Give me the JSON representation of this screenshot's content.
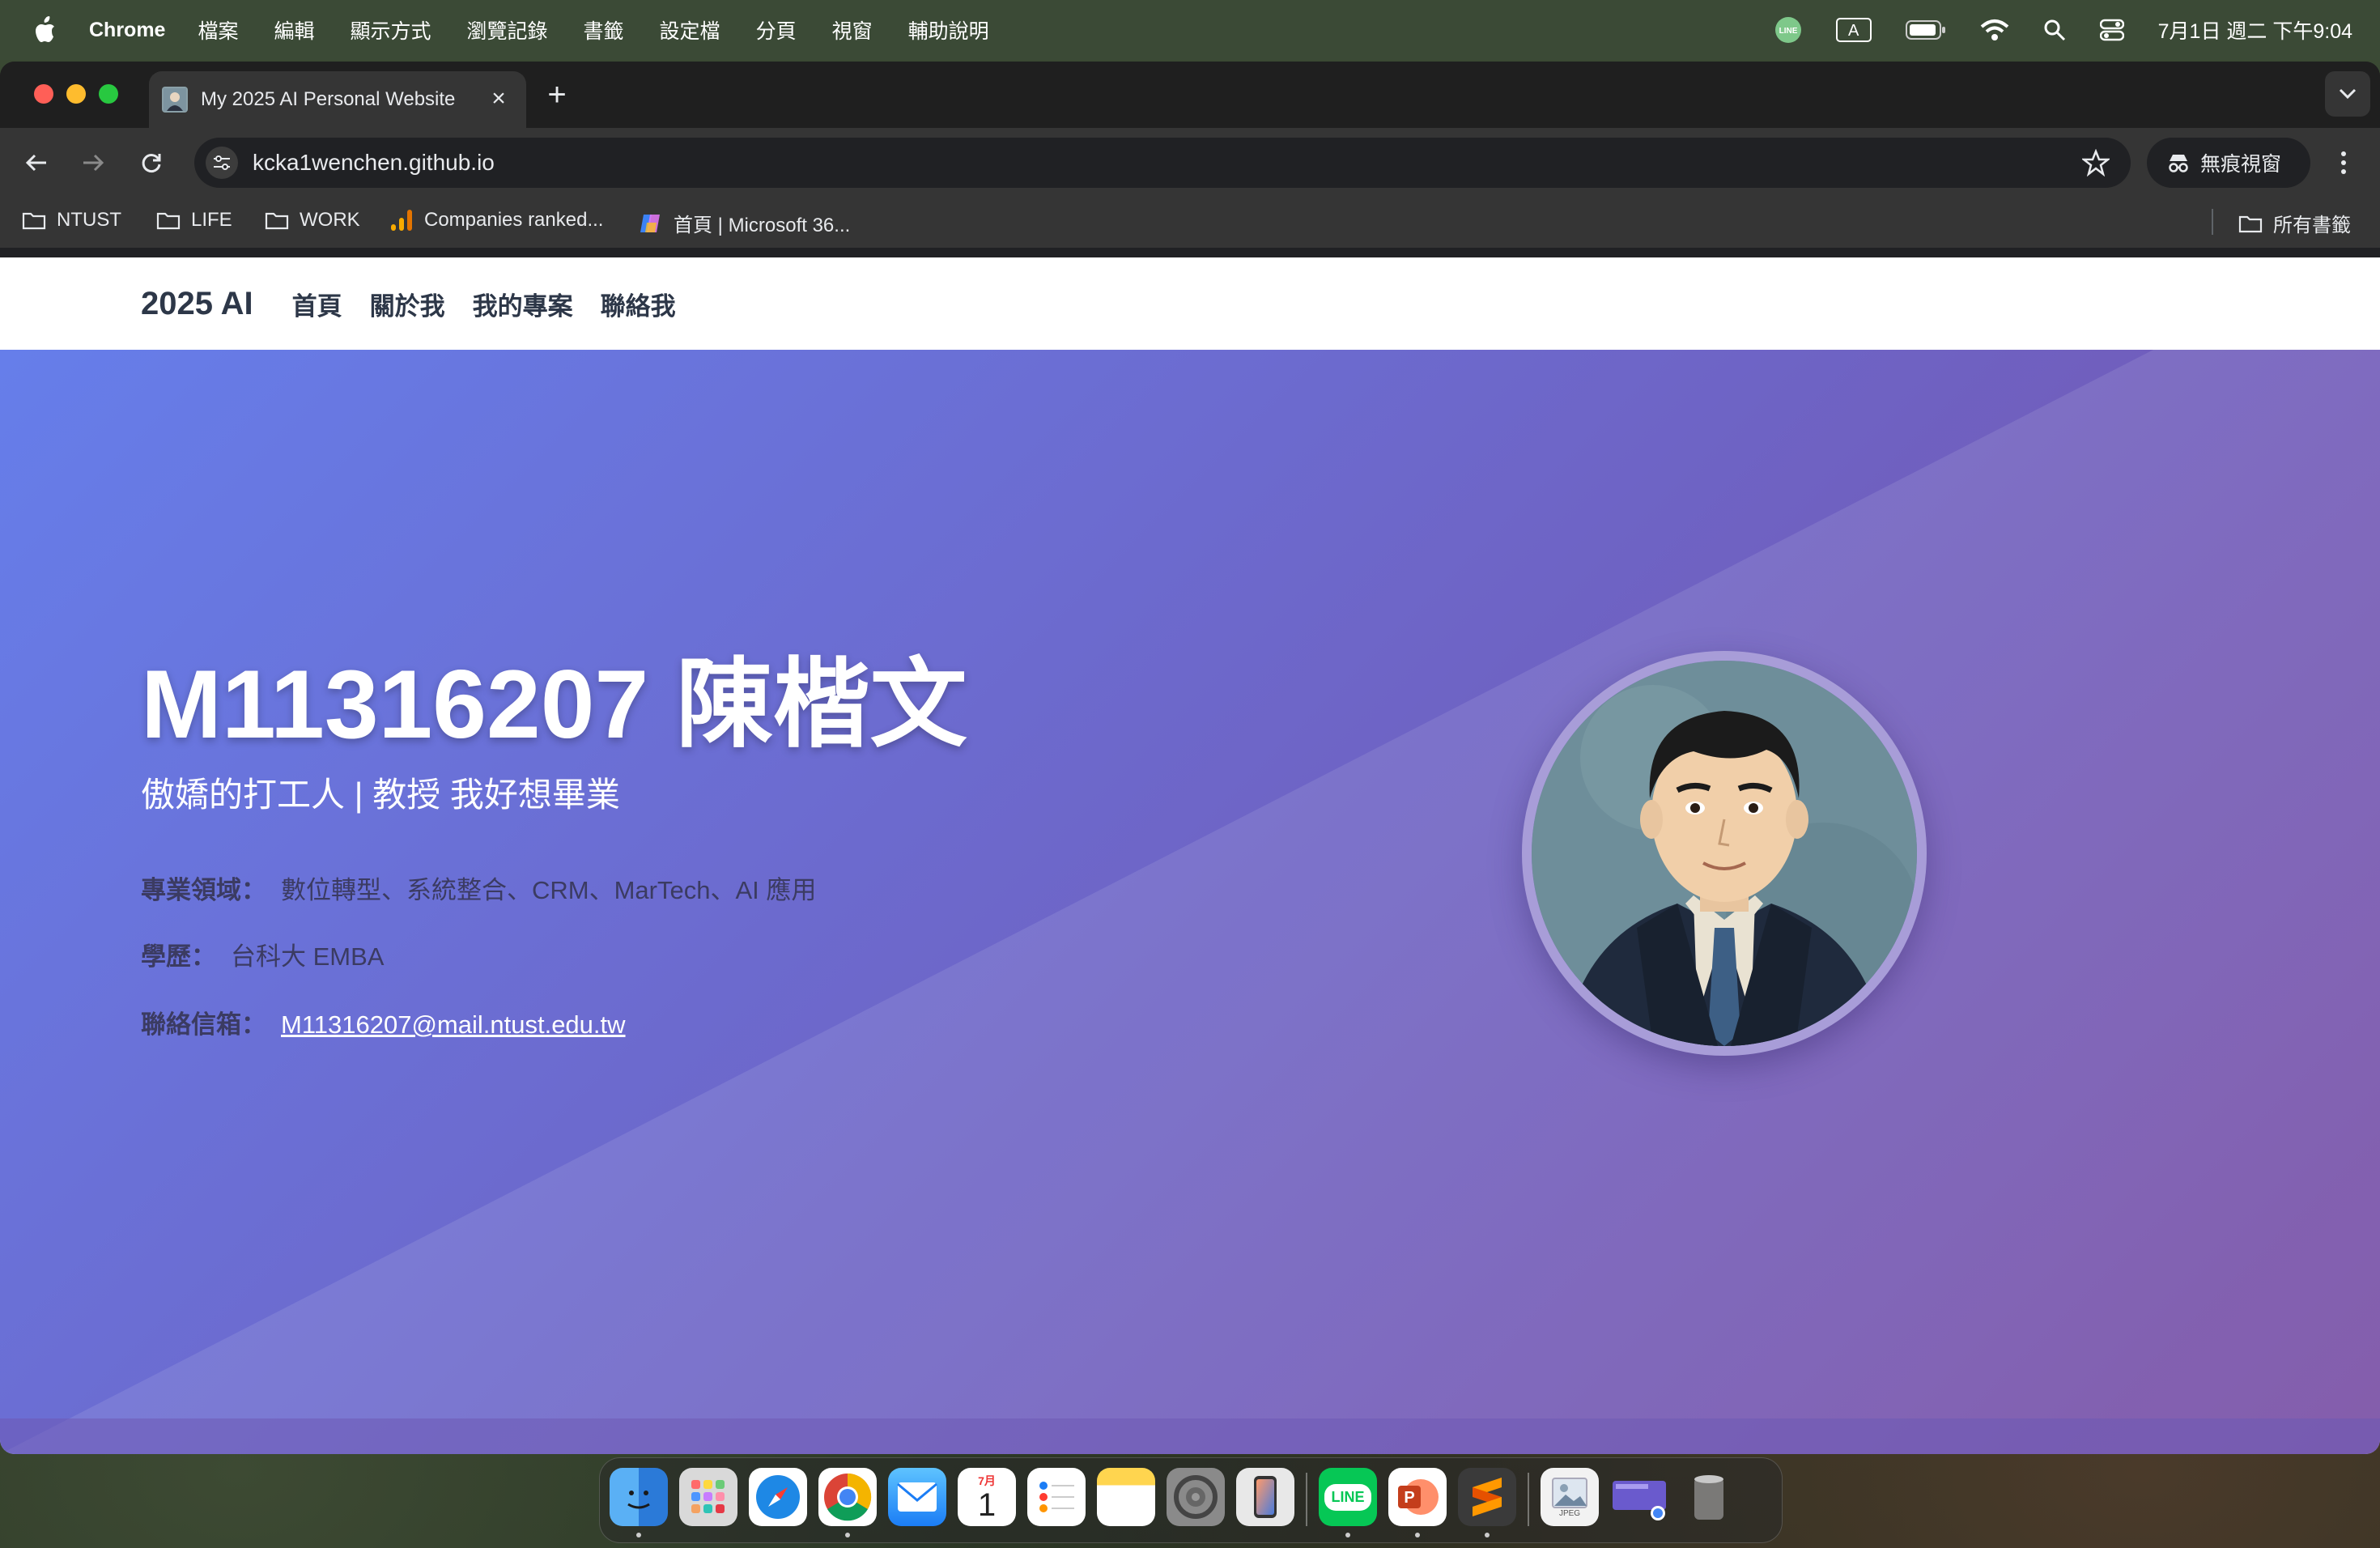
{
  "menubar": {
    "app_name": "Chrome",
    "menus": [
      "檔案",
      "編輯",
      "顯示方式",
      "瀏覽記錄",
      "書籤",
      "設定檔",
      "分頁",
      "視窗",
      "輔助說明"
    ],
    "input_method": "A",
    "datetime": "7月1日 週二 下午9:04"
  },
  "browser": {
    "tab_title": "My 2025 AI Personal Website",
    "url": "kcka1wenchen.github.io",
    "incognito_label": "無痕視窗",
    "bookmarks": [
      "NTUST",
      "LIFE",
      "WORK",
      "Companies ranked...",
      "首頁 | Microsoft 36..."
    ],
    "all_bookmarks": "所有書籤"
  },
  "site": {
    "brand": "2025 AI",
    "nav": [
      "首頁",
      "關於我",
      "我的專案",
      "聯絡我"
    ],
    "title": "M11316207 陳楷文",
    "subtitle": "傲嬌的打工人 | 教授 我好想畢業",
    "fields_label": "專業領域：",
    "fields_value": "數位轉型、系統整合、CRM、MarTech、AI 應用",
    "edu_label": "學歷：",
    "edu_value": "台科大 EMBA",
    "email_label": "聯絡信箱：",
    "email_value": "M11316207@mail.ntust.edu.tw"
  },
  "dock": {
    "calendar_month": "7月",
    "calendar_day": "1",
    "line_label": "LINE",
    "file_label": "JPEG"
  },
  "colors": {
    "hero_start": "#667eea",
    "hero_end": "#764ba2",
    "brand_text": "#2d3748"
  }
}
